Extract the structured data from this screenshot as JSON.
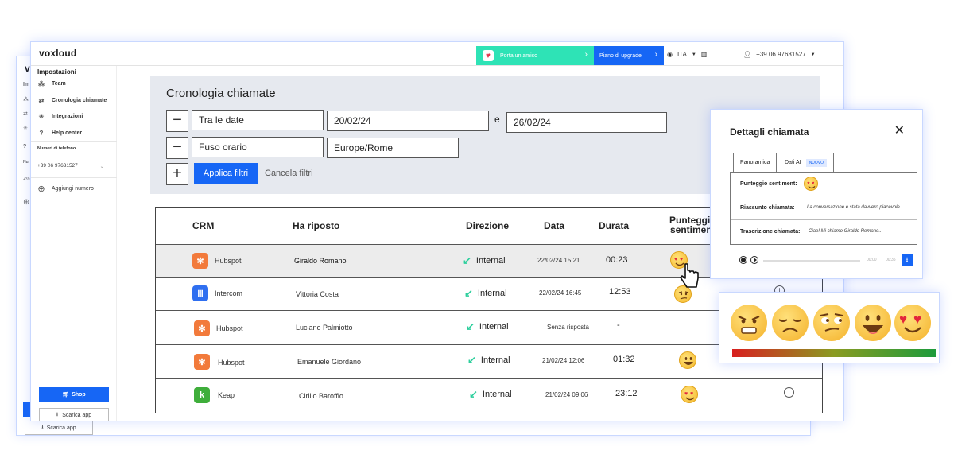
{
  "back_window": {
    "brand": "vo",
    "ghost_items": [
      "Im",
      "Nu",
      "+39",
      "?"
    ],
    "app_label": "Scarica app"
  },
  "topbar": {
    "logo": "voxloud",
    "friend_label": "Porta un amico",
    "upgrade_label": "Piano di upgrade",
    "language": "ITA",
    "phone": "+39 06 97631527"
  },
  "sidebar": {
    "heading": "Impostazioni",
    "items": [
      {
        "label": "Team",
        "icon": "team-icon"
      },
      {
        "label": "Cronologia chiamate",
        "icon": "swap-arrows-icon"
      },
      {
        "label": "Integrazioni",
        "icon": "integrations-icon"
      },
      {
        "label": "Help center",
        "icon": "help-icon"
      }
    ],
    "numbers_heading": "Numeri di telefono",
    "phone_number": "+39 06 97631527",
    "add_number": "Aggiungi numero",
    "shop_label": "Shop",
    "app_label": "Scarica app"
  },
  "filters": {
    "title": "Cronologia chiamate",
    "row1_type": "Tra le date",
    "date_from": "20/02/24",
    "and_label": "e",
    "date_to": "26/02/24",
    "row2_type": "Fuso orario",
    "timezone": "Europe/Rome",
    "apply_label": "Applica filtri",
    "cancel_label": "Cancela filtri"
  },
  "table": {
    "headers": {
      "crm": "CRM",
      "answered": "Ha riposto",
      "direction": "Direzione",
      "date": "Data",
      "duration": "Durata",
      "sentiment_line1": "Punteggio",
      "sentiment_line2": "sentiment"
    },
    "rows": [
      {
        "crm": "Hubspot",
        "crm_color": "#f27a3b",
        "answered": "Giraldo Romano",
        "direction": "Internal",
        "date": "22/02/24 15:21",
        "duration": "00:23",
        "sentiment": "love"
      },
      {
        "crm": "Intercom",
        "crm_color": "#2f6ff0",
        "answered": "Vittoria Costa",
        "direction": "Internal",
        "date": "22/02/24 16:45",
        "duration": "12:53",
        "sentiment": "skeptical"
      },
      {
        "crm": "Hubspot",
        "crm_color": "#f27a3b",
        "answered": "Luciano Palmiotto",
        "direction": "Internal",
        "date": "Senza risposta",
        "duration": "-",
        "sentiment": ""
      },
      {
        "crm": "Hubspot",
        "crm_color": "#f27a3b",
        "answered": "Emanuele Giordano",
        "direction": "Internal",
        "date": "21/02/24 12:06",
        "duration": "01:32",
        "sentiment": "happy"
      },
      {
        "crm": "Keap",
        "crm_color": "#3fae3b",
        "answered": "Cirillo Baroffio",
        "direction": "Internal",
        "date": "21/02/24 09:06",
        "duration": "23:12",
        "sentiment": "love"
      }
    ]
  },
  "dialog": {
    "title": "Dettagli chiamata",
    "tab_overview": "Panoramica",
    "tab_ai": "Dati AI",
    "badge": "NUOVO",
    "sentiment_key": "Punteggio sentiment:",
    "summary_key": "Riassunto chiamata:",
    "summary_value": "La conversazione è stata davvero piacevole...",
    "transcript_key": "Trascrizione chiamata:",
    "transcript_value": "Ciao! Mi chiamo Giraldo Romano...",
    "time_start": "00:00",
    "time_end": "00:35"
  },
  "emoji_scale": {
    "faces": [
      "angry",
      "sad",
      "skeptical",
      "happy",
      "love"
    ],
    "colors": [
      "#d81f1f",
      "#1d9b3b"
    ]
  }
}
